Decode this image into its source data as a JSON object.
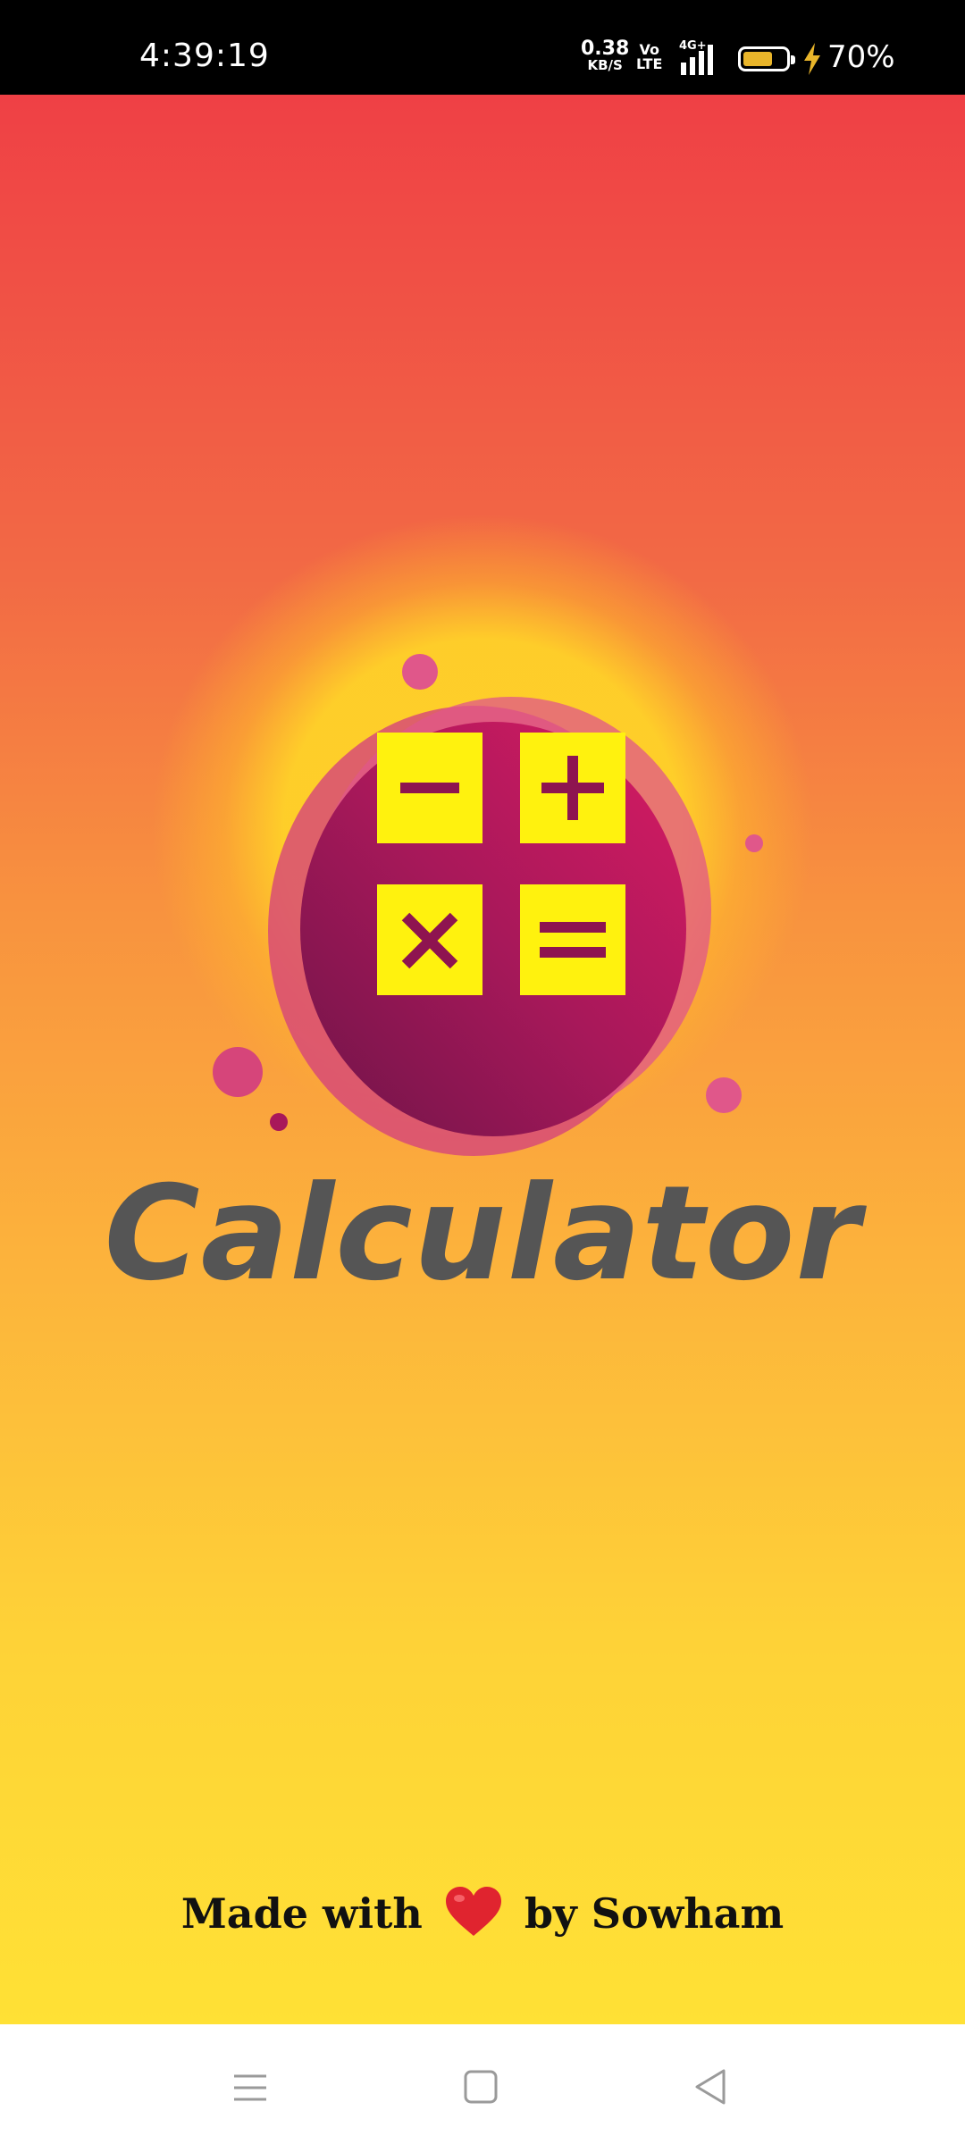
{
  "status_bar": {
    "time": "4:39:19",
    "net_speed_value": "0.38",
    "net_speed_unit": "KB/S",
    "volte_top": "Vo",
    "volte_bottom": "LTE",
    "network_type": "4G+",
    "battery_percent": "70%",
    "battery_level": 0.7,
    "charging": true
  },
  "splash": {
    "app_title": "Calculator",
    "logo_keys": [
      "minus",
      "plus",
      "multiply",
      "equals"
    ],
    "credit_prefix": "Made with",
    "credit_suffix": "by Sowham",
    "colors": {
      "gradient_top": "#ef4045",
      "gradient_bottom": "#ffe135",
      "blob": "#c2185b",
      "key": "#fff20e",
      "key_symbol": "#8e1450",
      "title": "#555555"
    }
  },
  "nav_bar": {
    "buttons": [
      "menu-icon",
      "home-icon",
      "back-icon"
    ]
  }
}
